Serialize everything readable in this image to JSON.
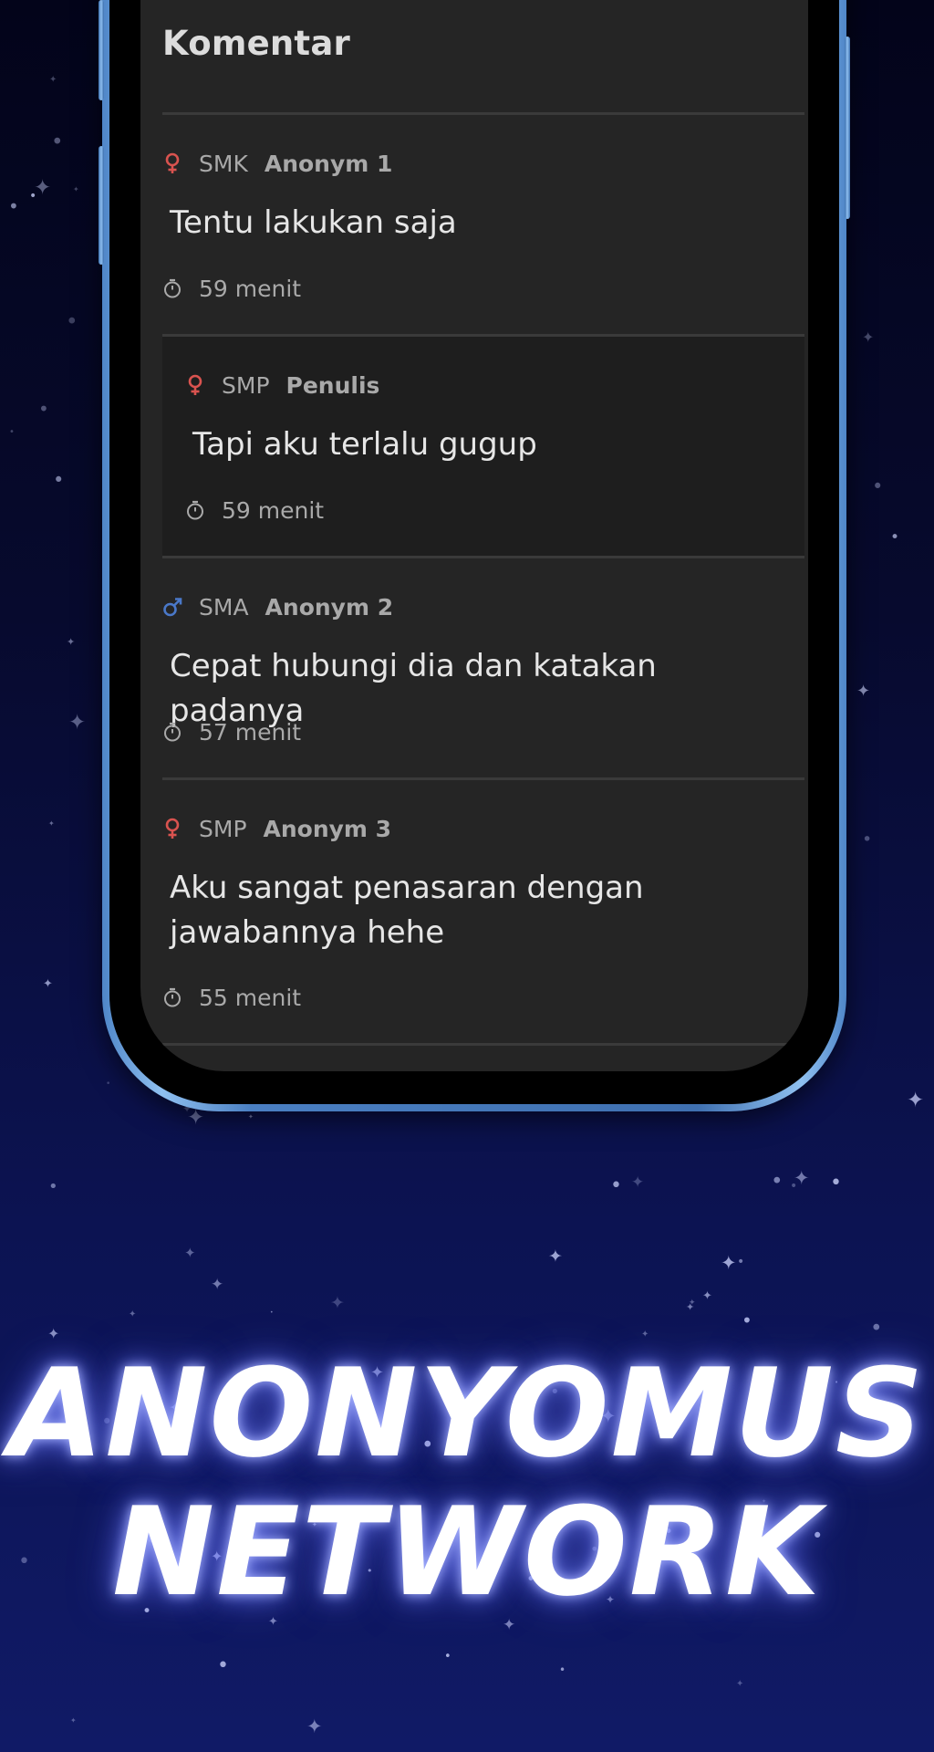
{
  "header": {
    "title": "Komentar"
  },
  "comments": [
    {
      "gender": "female",
      "school": "SMK",
      "author": "Anonym 1",
      "text": "Tentu lakukan saja",
      "time": "59 menit"
    },
    {
      "gender": "female",
      "school": "SMP",
      "author": "Penulis",
      "text": "Tapi aku terlalu gugup",
      "time": "59 menit"
    },
    {
      "gender": "male",
      "school": "SMA",
      "author": "Anonym 2",
      "text": "Cepat hubungi dia dan katakan padanya",
      "time": "57 menit"
    },
    {
      "gender": "female",
      "school": "SMP",
      "author": "Anonym 3",
      "text": "Aku sangat penasaran dengan jawabannya hehe",
      "time": "55 menit"
    }
  ],
  "headline": {
    "line1": "ANONYOMUS",
    "line2": "NETWORK"
  },
  "colors": {
    "female": "#d9534f",
    "male": "#4a78c8",
    "background": "#070a2e",
    "screen": "#252525"
  }
}
